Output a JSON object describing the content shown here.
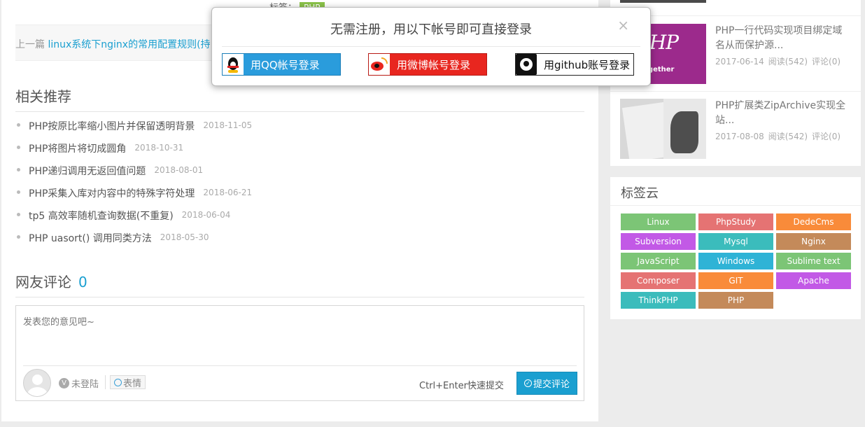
{
  "article": {
    "tag_label": "标签：",
    "tag_value": "PHP",
    "prev_label": "上一篇",
    "prev_link": "linux系统下nginx的常用配置规则(持..."
  },
  "recommend": {
    "title": "相关推荐",
    "items": [
      {
        "title": "PHP按原比率缩小图片并保留透明背景",
        "date": "2018-11-05"
      },
      {
        "title": "PHP将图片将切成圆角",
        "date": "2018-10-31"
      },
      {
        "title": "PHP递归调用无返回值问题",
        "date": "2018-08-01"
      },
      {
        "title": "PHP采集入库对内容中的特殊字符处理",
        "date": "2018-06-21"
      },
      {
        "title": "tp5 高效率随机查询数据(不重复)",
        "date": "2018-06-04"
      },
      {
        "title": "PHP uasort() 调用同类方法",
        "date": "2018-05-30"
      }
    ]
  },
  "comments": {
    "title": "网友评论",
    "count": "0",
    "placeholder": "发表您的意见吧~",
    "status": "未登陆",
    "emoji_label": "表情",
    "shortcut": "Ctrl+Enter快速提交",
    "submit_label": "提交评论"
  },
  "sidebar": {
    "articles": [
      {
        "title": "PHP一行代码实现项目绑定域名从而保护源...",
        "date": "2017-06-14",
        "reads": "阅读(542)",
        "comments": "评论(0)",
        "thumb_logo": "PHP",
        "thumb_tagline": "e together"
      },
      {
        "title": "PHP扩展类ZipArchive实现全站...",
        "date": "2017-08-08",
        "reads": "阅读(542)",
        "comments": "评论(0)"
      }
    ],
    "tagcloud": {
      "title": "标签云",
      "tags": [
        {
          "name": "Linux",
          "color": "#7cc576"
        },
        {
          "name": "PhpStudy",
          "color": "#e57373"
        },
        {
          "name": "DedeCms",
          "color": "#f98b3a"
        },
        {
          "name": "Subversion",
          "color": "#c259e6"
        },
        {
          "name": "Mysql",
          "color": "#3bbcbc"
        },
        {
          "name": "Nginx",
          "color": "#c48a5a"
        },
        {
          "name": "JavaScript",
          "color": "#7cc576"
        },
        {
          "name": "Windows",
          "color": "#2fb3d6"
        },
        {
          "name": "Sublime text",
          "color": "#7cc576"
        },
        {
          "name": "Composer",
          "color": "#e57373"
        },
        {
          "name": "GIT",
          "color": "#f98b3a"
        },
        {
          "name": "Apache",
          "color": "#c259e6"
        },
        {
          "name": "ThinkPHP",
          "color": "#3bbcbc"
        },
        {
          "name": "PHP",
          "color": "#c48a5a"
        }
      ]
    }
  },
  "modal": {
    "title": "无需注册，用以下帐号即可直接登录",
    "close": "×",
    "qq_label": "用QQ帐号登录",
    "weibo_label": "用微博帐号登录",
    "github_label": "用github账号登录"
  }
}
